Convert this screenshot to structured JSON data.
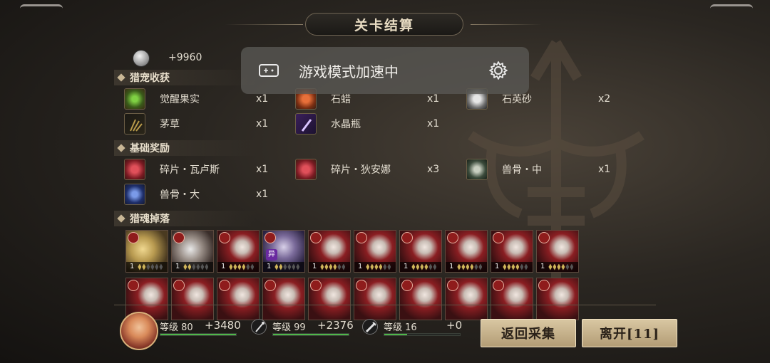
{
  "title": "关卡结算",
  "coin": {
    "value": "+9960"
  },
  "toast": {
    "text": "游戏模式加速中"
  },
  "sections": {
    "pet_harvest": {
      "label": "猎宠收获",
      "items": [
        {
          "name": "觉醒果实",
          "count": "x1",
          "icon": "green-gem-fruit",
          "color": "#6bbf3a"
        },
        {
          "name": "石蜡",
          "count": "x1",
          "icon": "orange-wax",
          "color": "#d0552a"
        },
        {
          "name": "石英砂",
          "count": "x2",
          "icon": "white-quartz",
          "color": "#cfcfcf"
        },
        {
          "name": "茅草",
          "count": "x1",
          "icon": "dry-grass",
          "color": "#8a7a3a"
        },
        {
          "name": "水晶瓶",
          "count": "x1",
          "icon": "crystal-vial",
          "color": "#7a4bb0"
        }
      ]
    },
    "basic_rewards": {
      "label": "基础奖励",
      "items": [
        {
          "name": "碎片・瓦卢斯",
          "count": "x1",
          "icon": "red-shard",
          "color": "#c4303a"
        },
        {
          "name": "碎片・狄安娜",
          "count": "x3",
          "icon": "red-shard",
          "color": "#c4303a"
        },
        {
          "name": "兽骨・中",
          "count": "x1",
          "icon": "beast-bone",
          "color": "#9aa39a"
        },
        {
          "name": "兽骨・大",
          "count": "x1",
          "icon": "blue-bone",
          "color": "#3a5cb0"
        }
      ]
    },
    "soul_drops": {
      "label": "猎魂掉落",
      "row1": [
        {
          "level": "1",
          "stars": 2,
          "art": "gold-warrior"
        },
        {
          "level": "1",
          "stars": 2,
          "art": "silver-warrior"
        },
        {
          "level": "1",
          "stars": 4,
          "art": "red-beast"
        },
        {
          "level": "1",
          "stars": 2,
          "art": "purple-witch",
          "tag": "异"
        },
        {
          "level": "1",
          "stars": 4,
          "art": "red-beast"
        },
        {
          "level": "1",
          "stars": 4,
          "art": "red-beast"
        },
        {
          "level": "1",
          "stars": 4,
          "art": "red-beast"
        },
        {
          "level": "1",
          "stars": 4,
          "art": "red-beast"
        },
        {
          "level": "1",
          "stars": 4,
          "art": "red-beast"
        },
        {
          "level": "1",
          "stars": 4,
          "art": "red-beast"
        }
      ],
      "row2_count": 10
    }
  },
  "footer": {
    "hero": {
      "level_label": "等级 80",
      "xp_gain": "+3480",
      "fill": 1.0
    },
    "weapon1": {
      "level_label": "等级 99",
      "xp_gain": "+2376",
      "fill": 1.0
    },
    "weapon2": {
      "level_label": "等级 16",
      "xp_gain": "+0",
      "fill": 0.3
    },
    "buttons": {
      "back": "返回采集",
      "leave": "离开[11]"
    }
  },
  "colors": {
    "accent_gold": "#cfb45a",
    "xp_green": "#4fb84a",
    "button_bg": "#d9c7a2"
  }
}
